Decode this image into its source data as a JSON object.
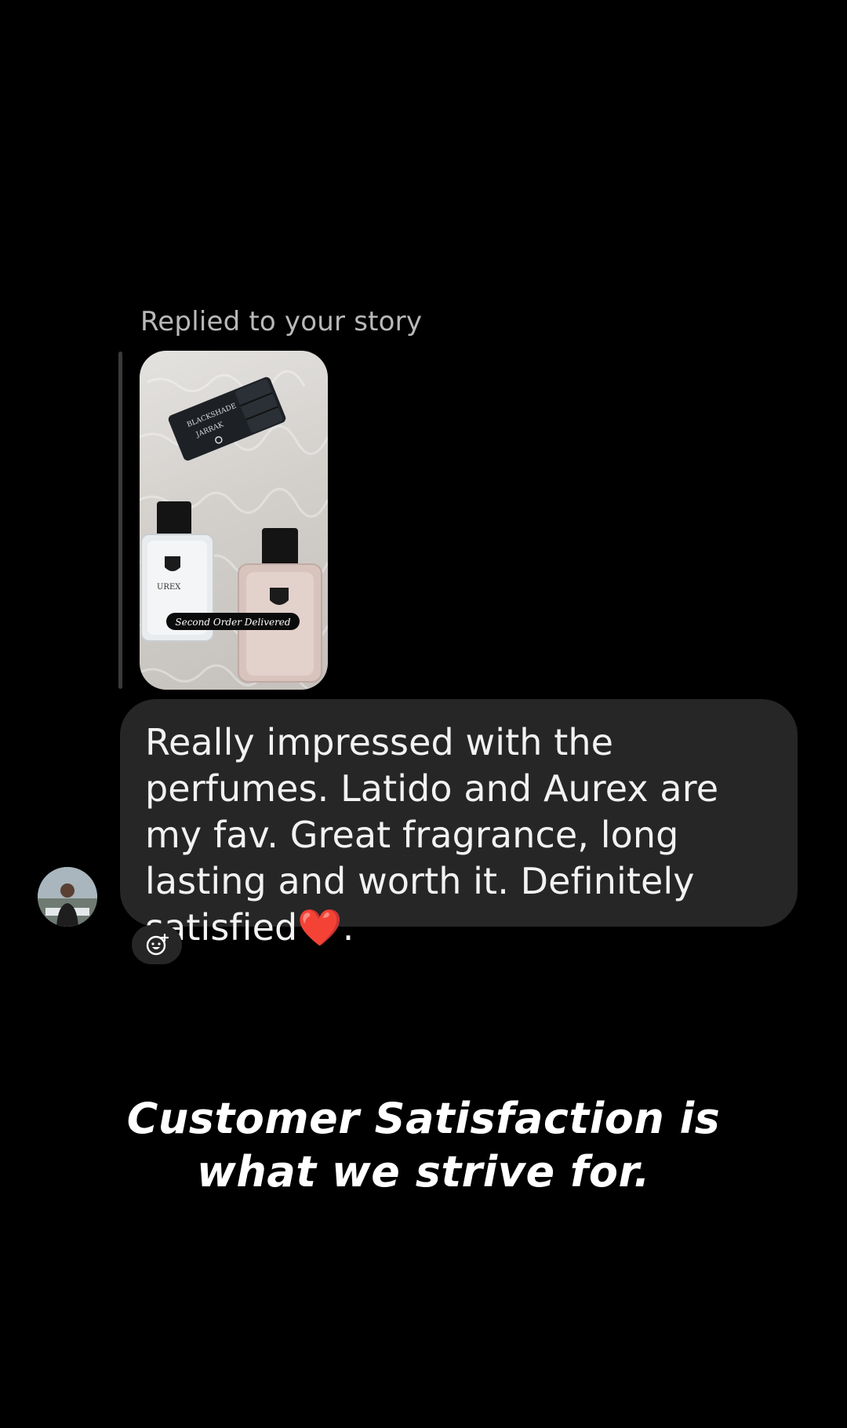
{
  "story_reply": {
    "label": "Replied to your story",
    "sticker_text": "Second Order Delivered",
    "product_labels": {
      "box_brand": "JARRAK",
      "box_line": "BLACKSHADE",
      "bottle_left_name": "UREX"
    }
  },
  "message": {
    "text": "Really impressed with the perfumes. Latido and Aurex are my fav. Great fragrance, long lasting and worth it. Definitely satisfied",
    "emoji": "❤️",
    "trailing": "."
  },
  "avatar": {
    "icon": "user-avatar"
  },
  "reaction_button": {
    "icon": "add-reaction-icon"
  },
  "caption": {
    "line1": "Customer Satisfaction is",
    "line2": "what we strive for."
  },
  "colors": {
    "background": "#000000",
    "bubble": "#262626",
    "label": "#b9b9b9",
    "text": "#f2f2f2",
    "heart": "#e0202c"
  }
}
